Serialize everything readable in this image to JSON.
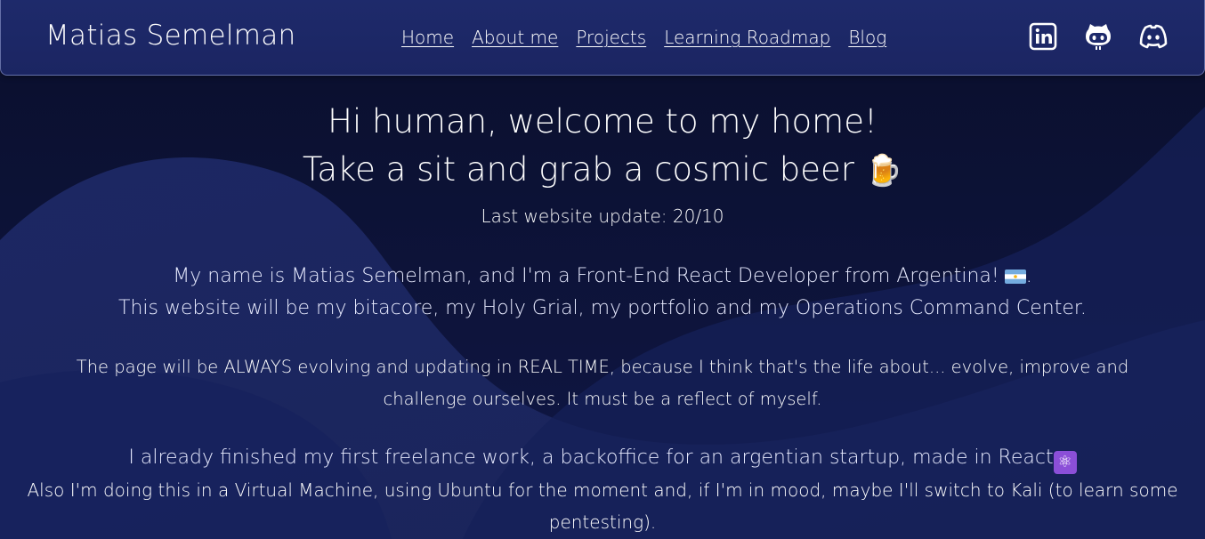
{
  "header": {
    "brand": "Matias Semelman",
    "nav": [
      {
        "label": "Home"
      },
      {
        "label": "About me"
      },
      {
        "label": "Projects"
      },
      {
        "label": "Learning Roadmap"
      },
      {
        "label": "Blog"
      }
    ],
    "social": [
      {
        "icon": "linkedin-icon"
      },
      {
        "icon": "github-icon"
      },
      {
        "icon": "discord-icon"
      }
    ]
  },
  "main": {
    "welcome_line1": "Hi human, welcome to my home!",
    "welcome_line2": "Take a sit and grab a cosmic beer",
    "beer_emoji": "🍺",
    "last_update": "Last website update: 20/10",
    "intro_line1": "My name is Matias Semelman, and I'm a Front-End React Developer from Argentina!",
    "intro_line1_end": ".",
    "intro_line2": "This website will be my bitacore, my Holy Grial, my portfolio and my Operations Command Center.",
    "evolve_text": "The page will be ALWAYS evolving and updating in REAL TIME, because I think that's the life about... evolve, improve and challenge ourselves. It must be a reflect of myself.",
    "freelance_text": "I already finished my first freelance work, a backoffice for an argentian startup, made in React",
    "atom_emoji": "⚛",
    "vm_text": "Also I'm doing this in a Virtual Machine, using Ubuntu for the moment and, if I'm in mood, maybe I'll switch to Kali (to learn some pentesting)."
  },
  "colors": {
    "header_bg": "#1e2a6b",
    "page_bg": "#0c1233",
    "wave": "#1b2560",
    "flag_blue": "#74acdf"
  }
}
